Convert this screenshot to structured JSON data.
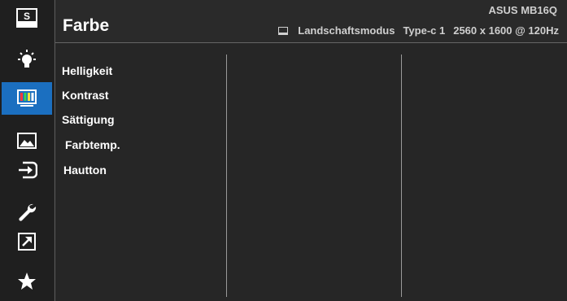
{
  "header": {
    "title": "Farbe",
    "model": "ASUS MB16Q",
    "mode": "Landschaftsmodus",
    "input": "Type-c 1",
    "resolution": "2560 x 1600 @ 120Hz"
  },
  "sidebar": {
    "items": [
      {
        "icon": "splendid-icon"
      },
      {
        "icon": "blue-light-filter-icon"
      },
      {
        "icon": "color-icon",
        "active": true
      },
      {
        "icon": "image-icon"
      },
      {
        "icon": "input-select-icon"
      },
      {
        "icon": "system-setup-icon"
      },
      {
        "icon": "shortcut-icon"
      },
      {
        "icon": "my-favorite-icon"
      }
    ],
    "active_color": "#1b6fc0"
  },
  "menu": {
    "items": [
      "Helligkeit",
      "Kontrast",
      "Sättigung",
      "Farbtemp.",
      "Hautton"
    ]
  }
}
